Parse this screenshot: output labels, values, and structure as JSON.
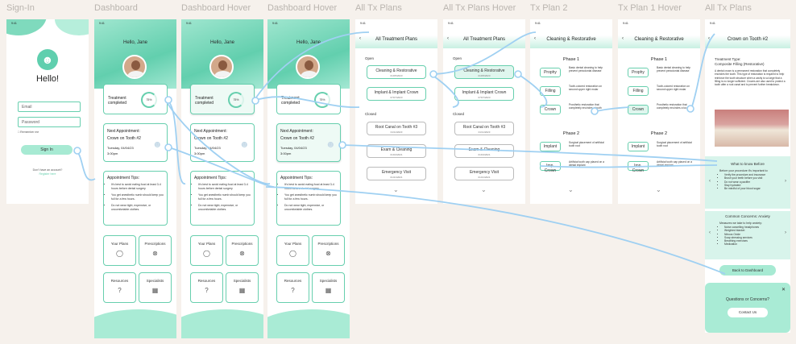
{
  "labels": [
    "Sign-In",
    "Dashboard",
    "Dashboard Hover",
    "Dashboard Hover",
    "All Tx Plans",
    "All Tx Plans Hover",
    "Tx Plan 2",
    "Tx Plan 1 Hover",
    "All Tx Plans"
  ],
  "status": {
    "time": "9:41"
  },
  "signin": {
    "greeting": "Hello!",
    "email_placeholder": "Email",
    "password_placeholder": "Password",
    "remember": "Remember me",
    "button": "Sign In",
    "no_account": "Don't have an account?",
    "register": "Register here"
  },
  "dash": {
    "hello": "Hello, Jane",
    "treatment": "Treatment completed",
    "percent": "75%",
    "next_title": "Next Appointment:",
    "next_tooth": "Crown on Tooth #2",
    "next_date": "Tuesday, 04/04/23",
    "next_time": "3:00pm",
    "tips_title": "Appointment Tips:",
    "tips": [
      "It's best to avoid eating food at least 3-4 hours before dental surgery",
      "You get anesthetic numb should keep you full for a few hours.",
      "Do not wear tight, expensive, or uncomfortable clothes."
    ],
    "tiles": [
      "Your Plans",
      "Prescriptions",
      "Resources",
      "Specialists"
    ]
  },
  "plans": {
    "title": "All Treatment Plans",
    "open": "Open",
    "closed": "Closed",
    "open_items": [
      {
        "name": "Cleaning & Restorative",
        "date": "01/05/2023"
      },
      {
        "name": "Implant & Implant Crown",
        "date": "07/07/2023"
      }
    ],
    "closed_items": [
      {
        "name": "Root Canal on Tooth #3",
        "date": "01/11/2023"
      },
      {
        "name": "Exam & Cleaning",
        "date": "01/04/2021"
      },
      {
        "name": "Emergency Visit",
        "date": "01/21/2021"
      }
    ]
  },
  "txplan": {
    "title": "Cleaning & Restorative",
    "phase1": "Phase 1",
    "phase2": "Phase 2",
    "p1": [
      {
        "name": "Prophy",
        "desc": "Basic dental cleaning to help prevent periodontal disease"
      },
      {
        "name": "Filling",
        "desc": "Tooth-colored restoration on second upper right molar"
      },
      {
        "name": "Crown",
        "desc": "Prosthetic restoration that completely encircles a tooth"
      }
    ],
    "p2": [
      {
        "name": "Implant",
        "desc": "Surgical placement of artificial tooth root"
      },
      {
        "name": "Imp. Crown",
        "desc": "Artificial tooth cap placed on a dental implant"
      }
    ]
  },
  "detail": {
    "title": "Crown on Tooth #2",
    "type_label": "Treatment Type:",
    "type_value": "Composite Filling (Restorative)",
    "desc": "A dental crown is a permanent restoration that completely encircles the tooth. This type of restoration is required to help reinforce the tooth structure when a cavity is so large that a filling is no longer sufficient. Crowns are also used to protect a tooth after a root canal and to prevent further breakdown.",
    "before_title": "What to know Before",
    "before_intro": "Before your procedure it's important to:",
    "before": [
      "Verify the procedure and insurance",
      "Brush your teeth before you visit",
      "Do not wear a pacifier",
      "Stay hydrated",
      "Be mindful of your blood sugar"
    ],
    "anxiety_title": "Common Concerns: Anxiety",
    "anxiety_intro": "Measures we take to help anxiety:",
    "anxiety": [
      "Noise cancelling headphones",
      "Weighted blanket",
      "Nitrous Oxide",
      "Soap stressing services",
      "Breathing exercises",
      "Medication"
    ],
    "back": "Back to Dashboard",
    "questions": "Questions or Concerns?",
    "contact": "Contact Us",
    "close": "✕"
  },
  "colors": {
    "accent": "#67cfae",
    "bg": "#f6f1ec",
    "link": "#9fd0f2"
  }
}
